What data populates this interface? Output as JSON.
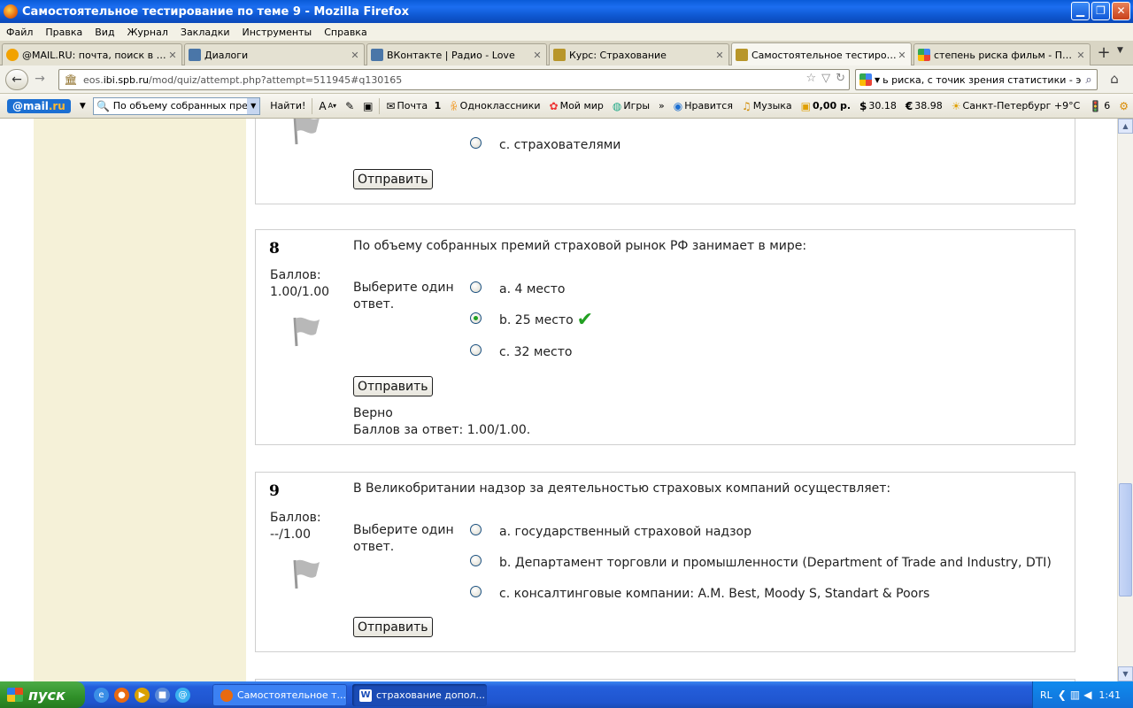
{
  "window": {
    "title": "Самостоятельное тестирование по теме 9 - Mozilla Firefox"
  },
  "menu": [
    "Файл",
    "Правка",
    "Вид",
    "Журнал",
    "Закладки",
    "Инструменты",
    "Справка"
  ],
  "tabs": [
    {
      "label": "@MAIL.RU: почта, поиск в ин...",
      "color": "#f2a200"
    },
    {
      "label": "Диалоги",
      "color": "#4a76a8"
    },
    {
      "label": "ВКонтакте | Радио - Love",
      "color": "#4a76a8"
    },
    {
      "label": "Курс: Страхование",
      "color": "#b8962a"
    },
    {
      "label": "Самостоятельное тестирован...",
      "color": "#b8962a"
    },
    {
      "label": "степень риска фильм - Поиск ...",
      "color": "#4285f4"
    }
  ],
  "url": {
    "prefix": "eos.",
    "domain": "ibi.spb.ru",
    "path": "/mod/quiz/attempt.php?attempt=511945#q130165"
  },
  "search": {
    "value": "ь риска, с точик зрения статистики - это:"
  },
  "mailbar": {
    "logo_main": "@mail",
    "logo_suffix": ".ru",
    "search_value": "По объему собранных преми",
    "find_label": "Найти!",
    "mail_label": "Почта",
    "mail_count": "1",
    "ok_label": "Одноклассники",
    "moimir_label": "Мой мир",
    "games_label": "Игры",
    "more_label": "»",
    "like_label": "Нравится",
    "music_label": "Музыка",
    "money_label": "0,00 р.",
    "usd_label": "30.18",
    "eur_label": "38.98",
    "weather_label": "Санкт-Петербург +9°C",
    "traffic_label": "6"
  },
  "questions": [
    {
      "option_c": "c. страхователями",
      "submit": "Отправить"
    },
    {
      "number": "8",
      "grade_label": "Баллов:",
      "grade_value": "1.00/1.00",
      "text": "По объему собранных премий страховой рынок РФ занимает в мире:",
      "prompt": "Выберите один ответ.",
      "options": [
        "a. 4 место",
        "b. 25 место",
        "c. 32 место"
      ],
      "selected_index": 1,
      "submit": "Отправить",
      "feedback_status": "Верно",
      "feedback_score": "Баллов за ответ: 1.00/1.00."
    },
    {
      "number": "9",
      "grade_label": "Баллов:",
      "grade_value": "--/1.00",
      "text": "В Великобритании надзор за деятельностью страховых компаний осуществляет:",
      "prompt": "Выберите один ответ.",
      "options": [
        "a. государственный страховой надзор",
        "b. Департамент торговли и промышленности (Department of Trade and Industry, DTI)",
        "c. консалтинговые компании: A.M. Best, Moody S, Standart & Poors"
      ],
      "submit": "Отправить"
    }
  ],
  "taskbar": {
    "start_label": "пуск",
    "tasks": [
      "Самостоятельное т...",
      "страхование допол..."
    ],
    "tray_lang": "RL",
    "clock": "1:41"
  }
}
